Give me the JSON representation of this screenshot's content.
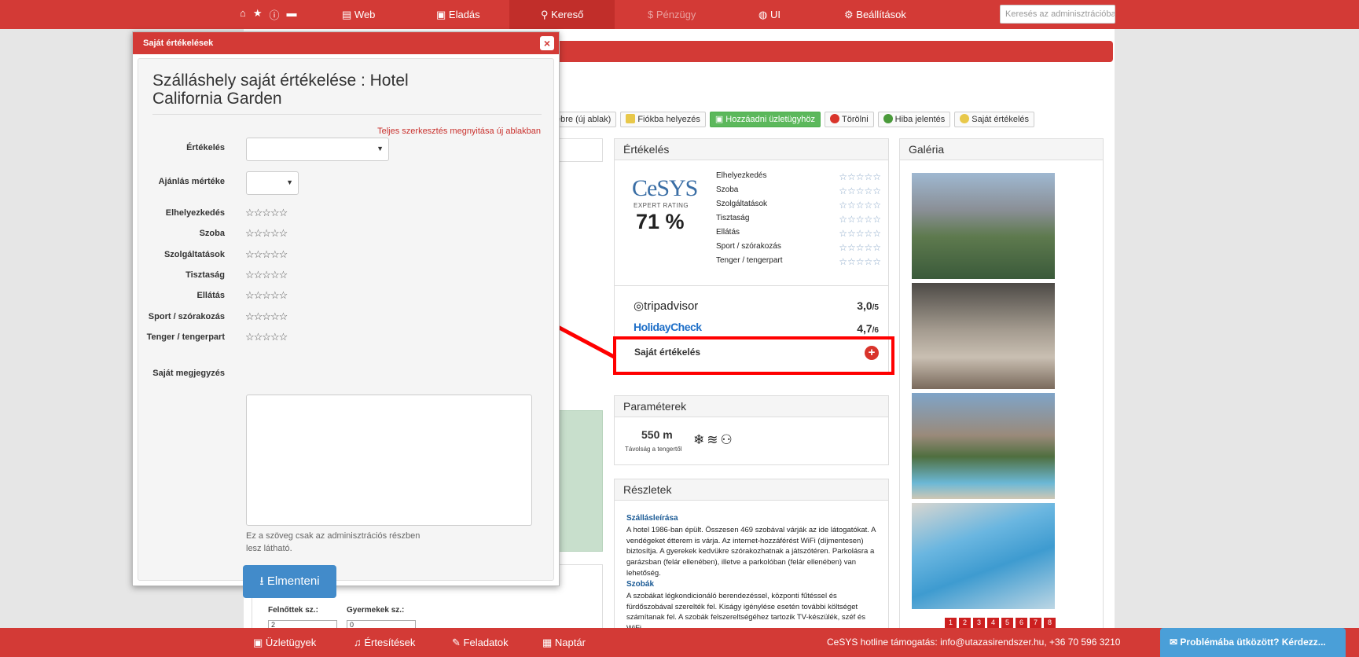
{
  "topnav": {
    "items": [
      {
        "label": "Web"
      },
      {
        "label": "Eladás"
      },
      {
        "label": "Kereső"
      },
      {
        "label": "$ Pénzügy"
      },
      {
        "label": "UI"
      },
      {
        "label": "Beállítások"
      }
    ],
    "search_placeholder": "Keresés az adminisztrációban"
  },
  "toolbar": {
    "buttons": [
      {
        "label": "ebre (új ablak)"
      },
      {
        "label": "Fiókba helyezés"
      },
      {
        "label": "Hozzáadni üzletügyhöz"
      },
      {
        "label": "Törölni"
      },
      {
        "label": "Hiba jelentés"
      },
      {
        "label": "Saját értékelés"
      }
    ]
  },
  "rating_panel": {
    "title": "Értékelés",
    "logo_text": "CeSYS",
    "logo_sub": "EXPERT RATING",
    "percent": "71 %",
    "categories": [
      "Elhelyezkedés",
      "Szoba",
      "Szolgáltatások",
      "Tisztaság",
      "Ellátás",
      "Sport / szórakozás",
      "Tenger / tengerpart"
    ],
    "tripadvisor_label": "tripadvisor",
    "tripadvisor_score": "3,0",
    "tripadvisor_max": "/5",
    "holidaycheck_label": "HolidayCheck",
    "holidaycheck_score": "4,7",
    "holidaycheck_max": "/6",
    "own_rating_label": "Saját értékelés"
  },
  "params_panel": {
    "title": "Paraméterek",
    "distance": "550 m",
    "distance_label": "Távolság a tengertől"
  },
  "details_panel": {
    "title": "Részletek",
    "section1_title": "Szállásleírása",
    "section1_text": "A hotel 1986-ban épült. Összesen 469 szobával várják az ide látogatókat. A vendégeket étterem is várja. Az internet-hozzáférést WiFi (díjmentesen) biztosítja. A gyerekek kedvükre szórakozhatnak a játszótéren. Parkolásra a garázsban (felár ellenében), illetve a parkolóban (felár ellenében) van lehetőség.",
    "section2_title": "Szobák",
    "section2_text": "A szobákat légkondicionáló berendezéssel, központi fűtéssel és fürdőszobával szerelték fel. Kiságy igénylése esetén további költséget számítanak fel. A szobák felszereltségéhez tartozik TV-készülék, széf és WiFi."
  },
  "gallery_panel": {
    "title": "Galéria",
    "pages": [
      "1",
      "2",
      "3",
      "4",
      "5",
      "6",
      "7",
      "8"
    ]
  },
  "booking": {
    "adults_label": "Felnőttek sz.:",
    "adults_value": "2",
    "children_label": "Gyermekek sz.:",
    "children_value": "0"
  },
  "modal": {
    "title": "Saját értékelések",
    "heading": "Szálláshely saját értékelése : Hotel California Garden",
    "full_edit_link": "Teljes szerkesztés megnyitása új ablakban",
    "rating_label": "Értékelés",
    "recommend_label": "Ajánlás mértéke",
    "categories": [
      "Elhelyezkedés",
      "Szoba",
      "Szolgáltatások",
      "Tisztaság",
      "Ellátás",
      "Sport / szórakozás",
      "Tenger / tengerpart"
    ],
    "stars": "☆☆☆☆☆",
    "note_label": "Saját megjegyzés",
    "note_hint": "Ez a szöveg csak az adminisztrációs részben lesz látható.",
    "save_label": "Elmenteni"
  },
  "bottombar": {
    "items": [
      {
        "label": "Üzletügyek"
      },
      {
        "label": "Értesítések"
      },
      {
        "label": "Feladatok"
      },
      {
        "label": "Naptár"
      }
    ],
    "hotline": "CeSYS hotline támogatás: info@utazasirendszer.hu, +36 70 596 3210",
    "help_button": "Problémába ütközött? Kérdezz..."
  },
  "colors": {
    "brand_red": "#d33a36",
    "primary_blue": "#428bca",
    "success_green": "#5cb85c",
    "annotation_red": "#ff0000"
  }
}
